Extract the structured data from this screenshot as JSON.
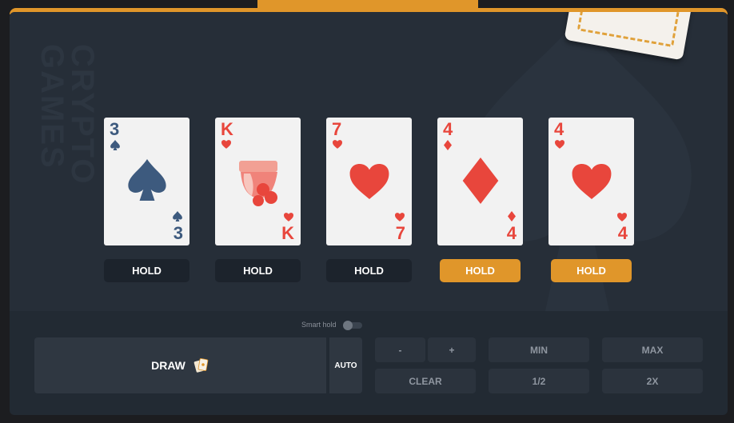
{
  "watermark": {
    "line1": "CRYPTO",
    "line2": "GAMES"
  },
  "cards": [
    {
      "rank": "3",
      "suit": "spade",
      "color": "#3d5a7e"
    },
    {
      "rank": "K",
      "suit": "heart",
      "color": "#e8463c"
    },
    {
      "rank": "7",
      "suit": "heart",
      "color": "#e8463c"
    },
    {
      "rank": "4",
      "suit": "diamond",
      "color": "#e8463c"
    },
    {
      "rank": "4",
      "suit": "heart",
      "color": "#e8463c"
    }
  ],
  "hold": {
    "label": "HOLD",
    "states": [
      false,
      false,
      false,
      true,
      true
    ]
  },
  "smart_hold": {
    "label": "Smart hold",
    "enabled": false
  },
  "draw": {
    "label": "DRAW",
    "icon": "cards-icon"
  },
  "auto": {
    "label": "AUTO"
  },
  "bet_controls": {
    "minus": "-",
    "plus": "+",
    "clear": "CLEAR",
    "min": "MIN",
    "half": "1/2",
    "max": "MAX",
    "double": "2X"
  },
  "colors": {
    "accent": "#e0962a",
    "panel": "#262e38",
    "card": "#f2f2f2"
  }
}
